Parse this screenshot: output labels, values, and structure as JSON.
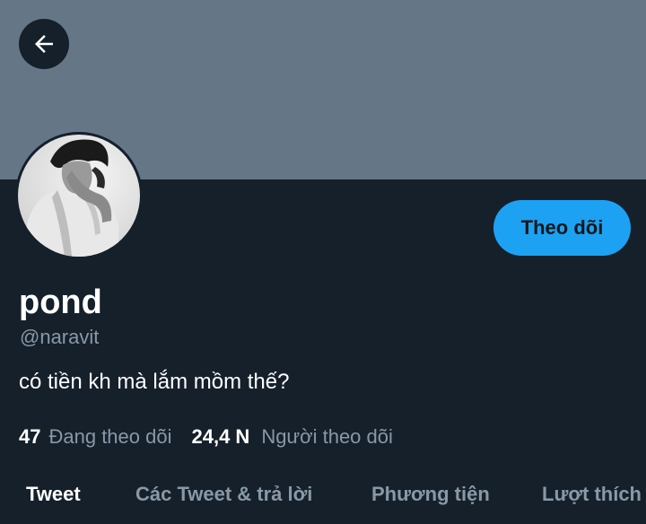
{
  "header": {
    "back_icon": "arrow-left-icon"
  },
  "profile": {
    "name": "pond",
    "handle": "@naravit",
    "bio": "có tiền kh mà lắm mồm thế?",
    "follow_label": "Theo dõi",
    "following_count": "47",
    "following_label": "Đang theo dõi",
    "followers_count": "24,4 N",
    "followers_label": "Người theo dõi"
  },
  "tabs": [
    {
      "label": "Tweet",
      "active": true
    },
    {
      "label": "Các Tweet & trả lời",
      "active": false
    },
    {
      "label": "Phương tiện",
      "active": false
    },
    {
      "label": "Lượt thích",
      "active": false
    }
  ],
  "colors": {
    "background": "#15202b",
    "banner": "#657786",
    "accent": "#1da1f2",
    "secondary_text": "#8899a6"
  }
}
